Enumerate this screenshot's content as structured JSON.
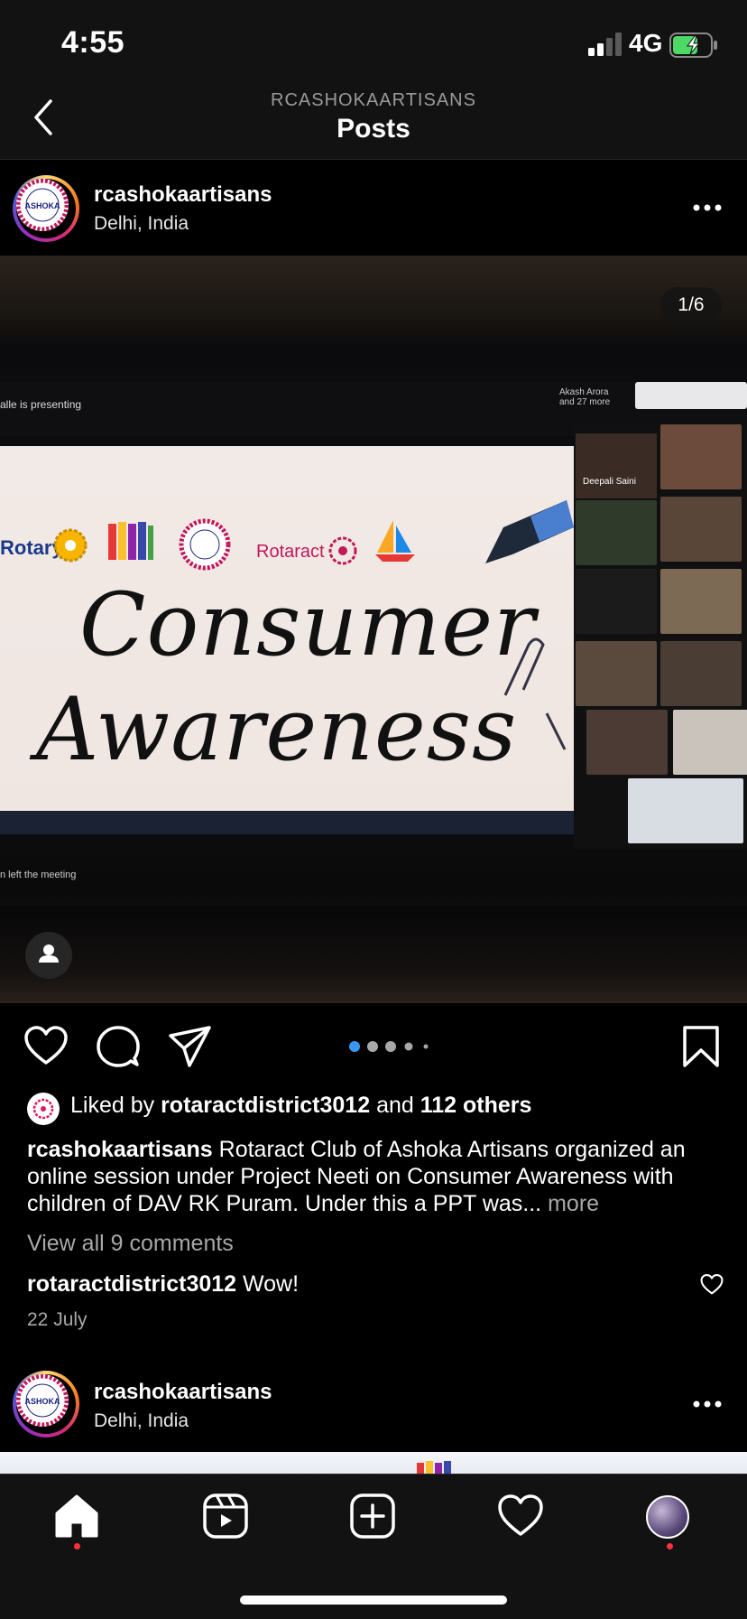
{
  "status_bar": {
    "time": "4:55",
    "network": "4G",
    "battery_color": "#4cd964"
  },
  "nav": {
    "subtitle": "RCASHOKAARTISANS",
    "title": "Posts"
  },
  "post": {
    "username": "rcashokaartisans",
    "location": "Delhi, India",
    "logo_text": "ASHOKA",
    "photo": {
      "counter": "1/6",
      "presenting_text": "alle is presenting",
      "participants_text": "Akash Arora\nand 27 more",
      "speaker_name": "Deepali Saini",
      "left_meeting_text": "n left the meeting",
      "slide_logos": [
        "Rotary",
        "Rotaract"
      ],
      "slide_title_line1": "Consumer",
      "slide_title_line2": "Awareness"
    },
    "carousel": {
      "total_dots": 5,
      "active_index": 0,
      "accent": "#3897f0"
    },
    "likes": {
      "prefix": "Liked by ",
      "user": "rotaractdistrict3012",
      "middle": " and ",
      "others": "112 others"
    },
    "caption": {
      "username": "rcashokaartisans",
      "text": " Rotaract Club of Ashoka Artisans organized an online session under Project Neeti on Consumer Awareness with children of DAV RK Puram.  Under this a PPT was...",
      "more": " more"
    },
    "view_comments": "View all 9 comments",
    "comment": {
      "user": "rotaractdistrict3012",
      "text": " Wow!"
    },
    "date": "22 July"
  },
  "next_post": {
    "username": "rcashokaartisans",
    "location": "Delhi, India"
  },
  "tab_bar": {
    "items": [
      {
        "name": "home-icon",
        "active": true
      },
      {
        "name": "reels-icon",
        "active": false
      },
      {
        "name": "new-post-icon",
        "active": false
      },
      {
        "name": "activity-heart-icon",
        "active": false
      },
      {
        "name": "profile-avatar",
        "active": false
      }
    ],
    "notification_color": "#ff3040"
  }
}
